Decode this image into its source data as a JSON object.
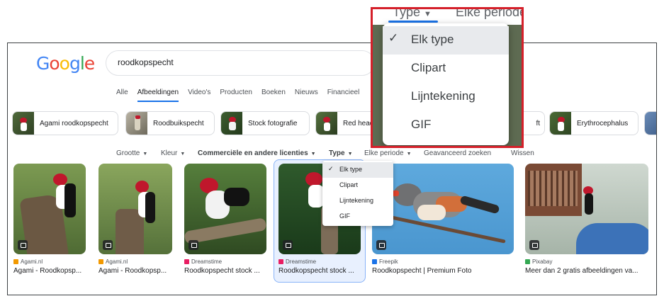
{
  "logo": "Google",
  "search": {
    "query": "roodkopspecht"
  },
  "tabs": [
    {
      "label": "Alle",
      "active": false
    },
    {
      "label": "Afbeeldingen",
      "active": true
    },
    {
      "label": "Video's",
      "active": false
    },
    {
      "label": "Producten",
      "active": false
    },
    {
      "label": "Boeken",
      "active": false
    },
    {
      "label": "Nieuws",
      "active": false
    },
    {
      "label": "Financieel",
      "active": false
    }
  ],
  "chips": [
    {
      "label": "Agami roodkopspecht"
    },
    {
      "label": "Roodbuikspecht"
    },
    {
      "label": "Stock fotografie"
    },
    {
      "label": "Red head"
    },
    {
      "label": "ft"
    },
    {
      "label": "Erythrocephalus"
    }
  ],
  "filters": {
    "grootte": "Grootte",
    "kleur": "Kleur",
    "licenties": "Commerciële en andere licenties",
    "type": "Type",
    "periode": "Elke periode",
    "geavanceerd": "Geavanceerd zoeken",
    "wissen": "Wissen"
  },
  "type_menu": {
    "check": "✓",
    "options": [
      "Elk type",
      "Clipart",
      "Lijntekening",
      "GIF"
    ],
    "selected": "Elk type"
  },
  "zoom": {
    "type_label": "Type",
    "period_label": "Elke periode"
  },
  "results": [
    {
      "source": "Agami.nl",
      "title": "Agami - Roodkopsp...",
      "source_color": "#f29900"
    },
    {
      "source": "Agami.nl",
      "title": "Agami - Roodkopsp...",
      "source_color": "#f29900"
    },
    {
      "source": "Dreamstime",
      "title": "Roodkopspecht stock ...",
      "source_color": "#e91e63"
    },
    {
      "source": "Dreamstime",
      "title": "Roodkopspecht stock ...",
      "source_color": "#e91e63"
    },
    {
      "source": "Freepik",
      "title": "Roodkopspecht | Premium Foto",
      "source_color": "#1a73e8"
    },
    {
      "source": "Pixabay",
      "title": "Meer dan 2 gratis afbeeldingen va...",
      "source_color": "#34a853"
    }
  ],
  "colors": {
    "accent": "#1a73e8",
    "callout": "#d5202a",
    "selected_bg": "#e8f0fe",
    "google_blue": "#4285f4",
    "google_red": "#ea4335",
    "google_yellow": "#fbbc05",
    "google_green": "#34a853"
  }
}
